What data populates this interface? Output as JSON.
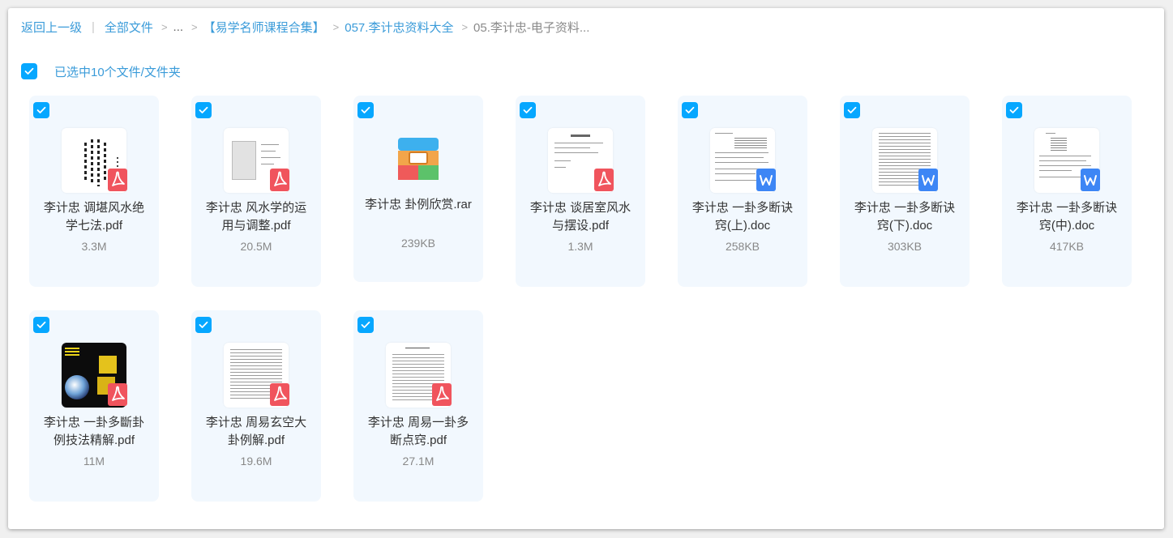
{
  "breadcrumb": {
    "back": "返回上一级",
    "separator_bar": "|",
    "all_files": "全部文件",
    "chevron": ">",
    "ellipsis": "...",
    "level1": "【易学名师课程合集】",
    "level2": "057.李计忠资料大全",
    "current": "05.李计忠-电子资料..."
  },
  "selection": {
    "checked": true,
    "text": "已选中10个文件/文件夹"
  },
  "colors": {
    "accent": "#06a7ff",
    "link": "#3a9bd9",
    "card_bg": "#f2f8fe",
    "pdf": "#f0545d",
    "doc": "#3d86f5"
  },
  "files": [
    {
      "name": "李计忠 调堪风水绝学七法.pdf",
      "size": "3.3M",
      "type": "pdf",
      "icon": "pdf-icon"
    },
    {
      "name": "李计忠 风水学的运用与调整.pdf",
      "size": "20.5M",
      "type": "pdf",
      "icon": "pdf-icon"
    },
    {
      "name": "李计忠 卦例欣赏.rar",
      "size": "239KB",
      "type": "rar",
      "icon": "archive-icon"
    },
    {
      "name": "李计忠 谈居室风水与摆设.pdf",
      "size": "1.3M",
      "type": "pdf",
      "icon": "pdf-icon"
    },
    {
      "name": "李计忠 一卦多断诀窍(上).doc",
      "size": "258KB",
      "type": "doc",
      "icon": "word-icon"
    },
    {
      "name": "李计忠 一卦多断诀窍(下).doc",
      "size": "303KB",
      "type": "doc",
      "icon": "word-icon"
    },
    {
      "name": "李计忠 一卦多断诀窍(中).doc",
      "size": "417KB",
      "type": "doc",
      "icon": "word-icon"
    },
    {
      "name": "李计忠 一卦多斷卦例技法精解.pdf",
      "size": "11M",
      "type": "pdf",
      "icon": "pdf-icon"
    },
    {
      "name": "李计忠 周易玄空大卦例解.pdf",
      "size": "19.6M",
      "type": "pdf",
      "icon": "pdf-icon"
    },
    {
      "name": "李计忠 周易一卦多断点窍.pdf",
      "size": "27.1M",
      "type": "pdf",
      "icon": "pdf-icon"
    }
  ]
}
